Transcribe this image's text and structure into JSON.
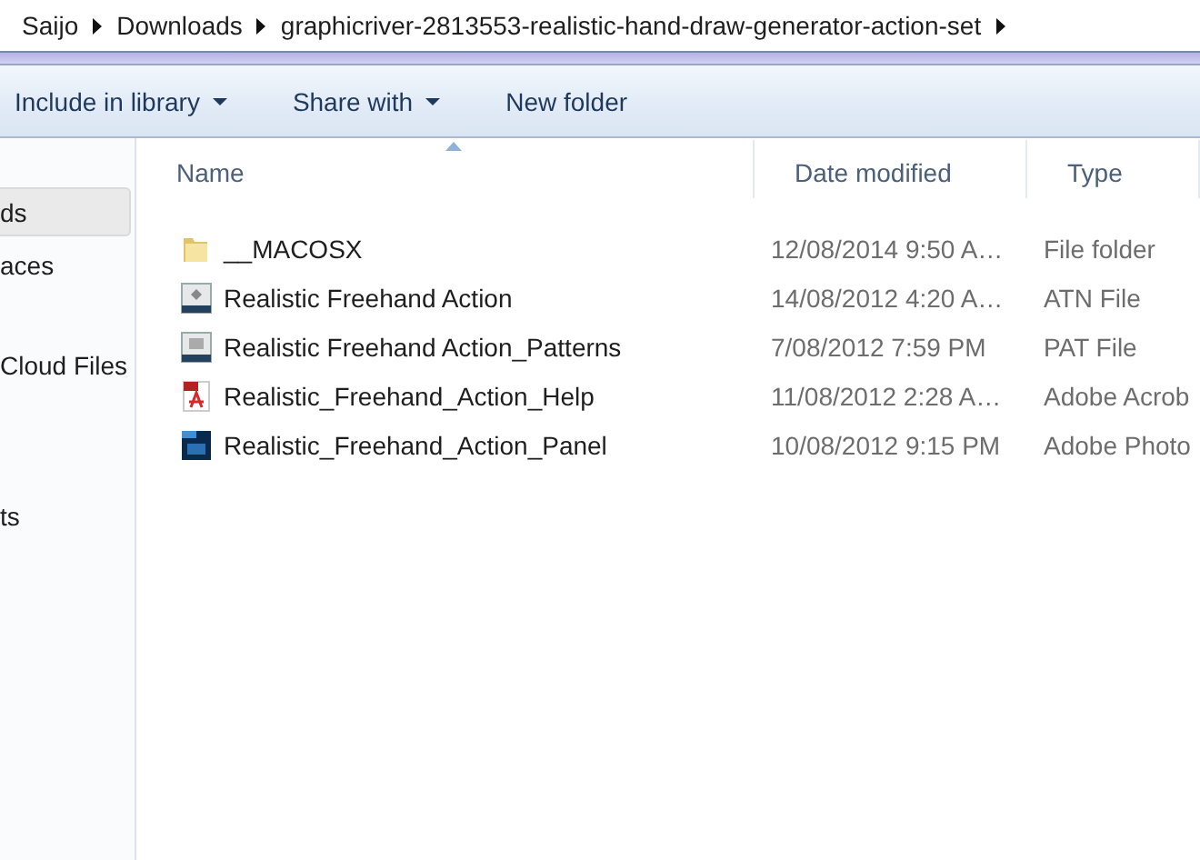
{
  "breadcrumb": [
    "Saijo",
    "Downloads",
    "graphicriver-2813553-realistic-hand-draw-generator-action-set"
  ],
  "toolbar": [
    {
      "label": "Include in library",
      "dropdown": true
    },
    {
      "label": "Share with",
      "dropdown": true
    },
    {
      "label": "New folder",
      "dropdown": false
    }
  ],
  "sidebar": {
    "groups": [
      [
        {
          "label": "ds",
          "selected": true
        },
        {
          "label": "aces",
          "selected": false
        }
      ],
      [
        {
          "label": "Cloud Files",
          "selected": false
        }
      ],
      [
        {
          "label": "ts",
          "selected": false
        }
      ]
    ]
  },
  "table": {
    "columns": [
      {
        "label": "Name",
        "sorted": true
      },
      {
        "label": "Date modified",
        "sorted": false
      },
      {
        "label": "Type",
        "sorted": false
      }
    ],
    "rows": [
      {
        "kind": "folder",
        "name": "__MACOSX",
        "date": "12/08/2014 9:50 A…",
        "type": "File folder"
      },
      {
        "kind": "atn",
        "name": "Realistic Freehand Action",
        "date": "14/08/2012 4:20 A…",
        "type": "ATN File"
      },
      {
        "kind": "pat",
        "name": "Realistic Freehand Action_Patterns",
        "date": "7/08/2012 7:59 PM",
        "type": "PAT File"
      },
      {
        "kind": "pdf",
        "name": "Realistic_Freehand_Action_Help",
        "date": "11/08/2012 2:28 A…",
        "type": "Adobe Acrob"
      },
      {
        "kind": "psd",
        "name": "Realistic_Freehand_Action_Panel",
        "date": "10/08/2012 9:15 PM",
        "type": "Adobe Photo"
      }
    ]
  }
}
